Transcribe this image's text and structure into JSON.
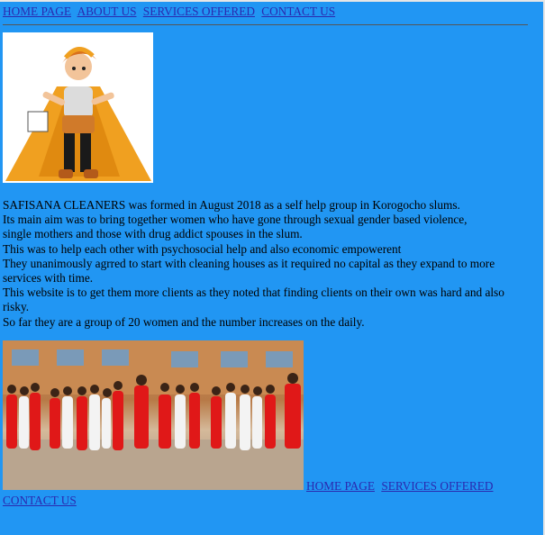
{
  "nav_top": {
    "home": "HOME PAGE",
    "about": "ABOUT US",
    "services": "SERVICES OFFERED",
    "contact": "CONTACT US"
  },
  "about": {
    "lines": [
      "SAFISANA CLEANERS was formed in August 2018 as a self help group in Korogocho slums.",
      "Its main aim was to bring together women who have gone through sexual gender based violence,",
      "single mothers and those with drug addict spouses in the slum.",
      "This was to help each other with psychosocial help and also economic empowerent",
      "They unanimously agrred to start with cleaning houses as it required no capital as they expand to more services with time.",
      "This website is to get them more clients as they noted that finding clients on their own was hard and also risky.",
      "So far they are a group of 20 women and the number increases on the daily."
    ]
  },
  "nav_bottom": {
    "home": "HOME PAGE",
    "services": "SERVICES OFFERED",
    "contact": "CONTACT US"
  },
  "colors": {
    "background": "#2196f3",
    "link": "#2a2ab0"
  }
}
